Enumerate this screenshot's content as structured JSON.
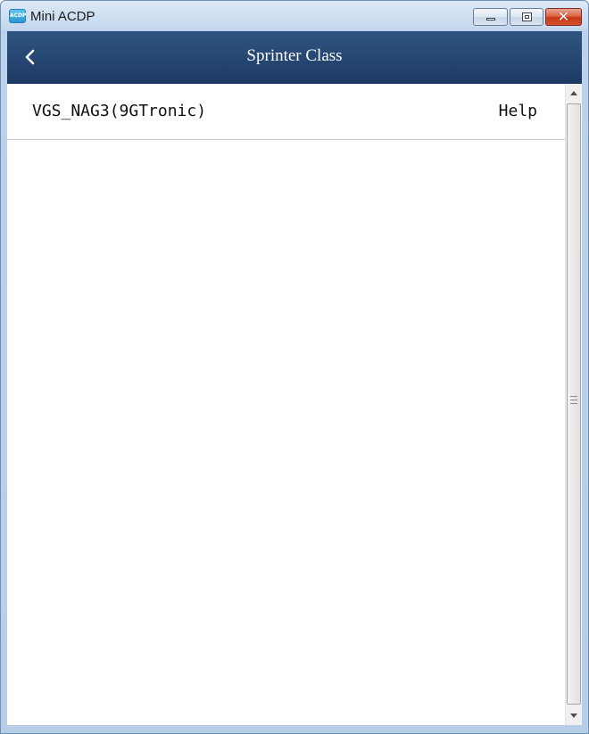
{
  "window": {
    "title": "Mini ACDP",
    "icon": "app-icon",
    "icon_text": "ACDP"
  },
  "header": {
    "title": "Sprinter Class",
    "back_icon": "chevron-left-icon"
  },
  "list": {
    "items": [
      {
        "label": "VGS_NAG3(9GTronic)",
        "action": "Help"
      }
    ]
  },
  "colors": {
    "header_bg": "#1f3f6b",
    "header_text": "#ffffff",
    "close_button": "#c9452a"
  }
}
